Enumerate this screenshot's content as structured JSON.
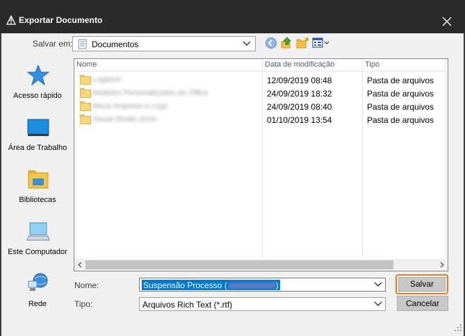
{
  "window": {
    "title": "Exportar Documento",
    "icon": "app-pyramid-icon",
    "close_icon": "close-icon"
  },
  "toolbar": {
    "save_in_label": "Salvar em:",
    "save_in_value": "Documentos",
    "buttons": [
      "back-arrow-icon",
      "up-folder-icon",
      "new-folder-icon",
      "view-menu-icon"
    ]
  },
  "places": [
    {
      "label": "Acesso rápido",
      "icon": "star-icon"
    },
    {
      "label": "Área de Trabalho",
      "icon": "desktop-icon"
    },
    {
      "label": "Bibliotecas",
      "icon": "libraries-icon"
    },
    {
      "label": "Este Computador",
      "icon": "computer-icon"
    },
    {
      "label": "Rede",
      "icon": "network-icon"
    }
  ],
  "list": {
    "columns": [
      "Nome",
      "Data de modificação",
      "Tipo"
    ],
    "rows": [
      {
        "name": "Logitech",
        "date": "12/09/2019 08:48",
        "type": "Pasta de arquivos"
      },
      {
        "name": "Modelos Personalizados do Office",
        "date": "24/09/2019 18:32",
        "type": "Pasta de arquivos"
      },
      {
        "name": "Meus Arquivos e Logs",
        "date": "24/09/2019 08:40",
        "type": "Pasta de arquivos"
      },
      {
        "name": "Visual Studio 2019",
        "date": "01/10/2019 13:54",
        "type": "Pasta de arquivos"
      }
    ]
  },
  "form": {
    "name_label": "Nome:",
    "name_value": "Suspensão Processo (",
    "name_value_end": ")",
    "type_label": "Tipo:",
    "type_value": "Arquivos Rich Text (*.rtf)"
  },
  "buttons": {
    "save": "Salvar",
    "cancel": "Cancelar"
  },
  "colors": {
    "accent_highlight": "#e87d1e",
    "selection": "#0078d7",
    "titlebar": "#2b2b2b"
  }
}
